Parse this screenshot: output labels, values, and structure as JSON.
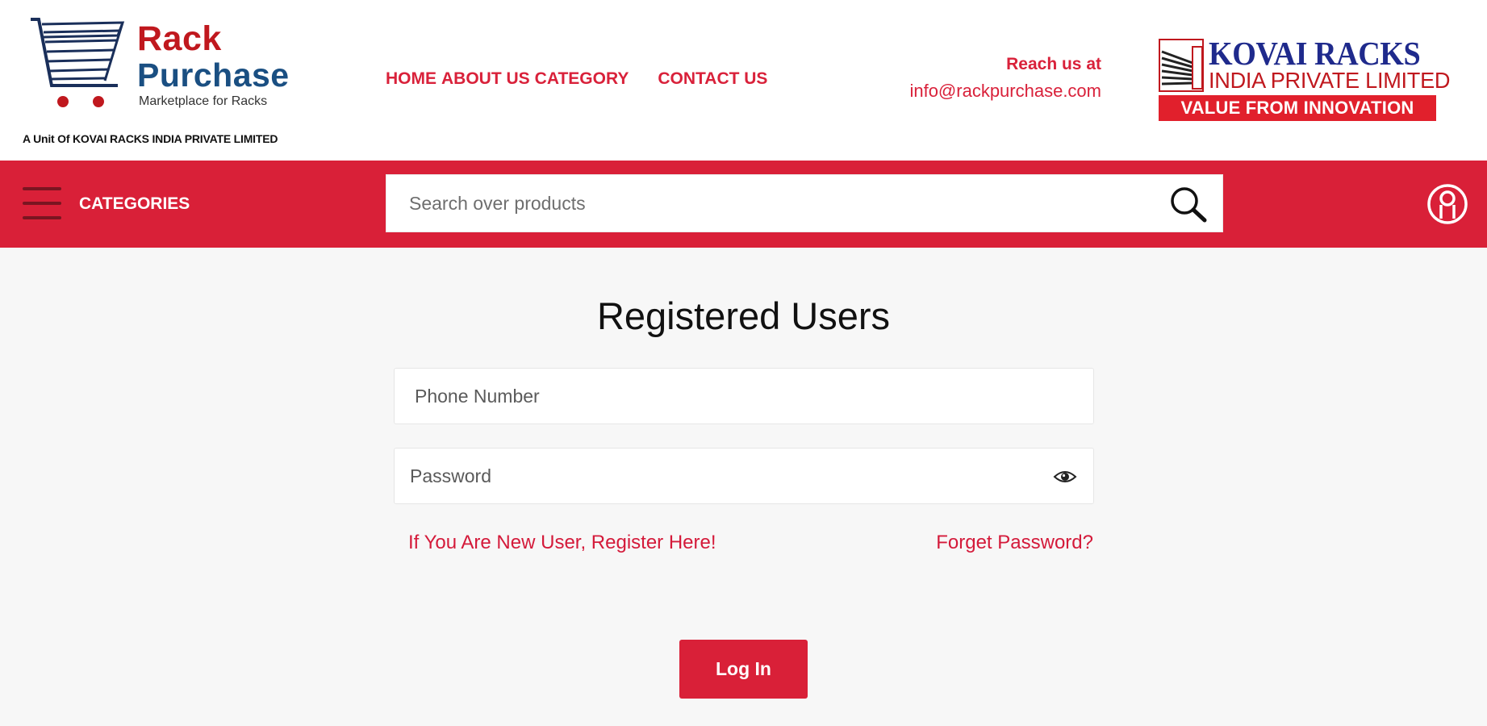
{
  "header": {
    "brand": {
      "name_line1": "Rack",
      "name_line2": "Purchase",
      "tagline": "Marketplace for Racks",
      "unit": "A Unit Of KOVAI RACKS INDIA PRIVATE LIMITED"
    },
    "nav": {
      "home": "HOME",
      "about": "ABOUT US",
      "category": "CATEGORY",
      "contact": "CONTACT US"
    },
    "contact": {
      "label": "Reach us at",
      "email": "info@rackpurchase.com"
    },
    "partner": {
      "name": "KOVAI RACKS",
      "subtitle": "INDIA PRIVATE LIMITED",
      "slogan": "VALUE FROM INNOVATION"
    }
  },
  "toolbar": {
    "menu_icon": "hamburger-icon",
    "categories_label": "CATEGORIES",
    "search_placeholder": "Search over products",
    "search_icon": "search-icon",
    "account_icon": "user-icon"
  },
  "login": {
    "title": "Registered Users",
    "phone_placeholder": "Phone Number",
    "password_placeholder": "Password",
    "show_password_icon": "eye-icon",
    "register_link": "If You Are New User, Register Here!",
    "forgot_link": "Forget Password?",
    "submit_label": "Log In"
  },
  "colors": {
    "accent_red": "#d92038",
    "brand_blue": "#1a4f82",
    "partner_blue": "#1f2a8c",
    "page_background": "#f7f7f7"
  }
}
